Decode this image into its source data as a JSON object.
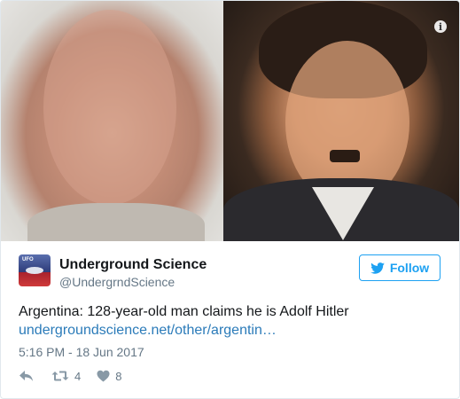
{
  "media": {
    "info_glyph": "i",
    "left_photo_icon": "photo-image",
    "right_photo_icon": "photo-image"
  },
  "author": {
    "name": "Underground Science",
    "handle": "@UndergrndScience",
    "avatar_icon": "ufo-avatar",
    "avatar_tag": "UFO"
  },
  "follow_button": {
    "label": "Follow",
    "icon": "twitter-bird-icon",
    "color": "#1da1f2"
  },
  "tweet": {
    "text": "Argentina: 128-year-old man claims he is Adolf Hitler",
    "link_text": "undergroundscience.net/other/argentin…",
    "link_color": "#2b7bb9",
    "timestamp": "5:16 PM - 18 Jun 2017"
  },
  "actions": {
    "reply_icon": "reply-icon",
    "retweet_icon": "retweet-icon",
    "retweet_count": "4",
    "like_icon": "heart-icon",
    "like_count": "8",
    "icon_color": "#657786"
  }
}
